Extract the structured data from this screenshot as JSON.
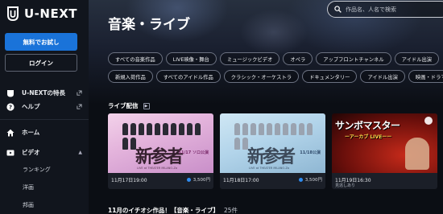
{
  "brand": {
    "logo_text": "U-NEXT"
  },
  "sidebar": {
    "trial_button": "無料でお試し",
    "login_button": "ログイン",
    "links": [
      {
        "label": "U-NEXTの特長"
      },
      {
        "label": "ヘルプ"
      }
    ],
    "nav": {
      "home": "ホーム",
      "video": "ビデオ",
      "video_sub": [
        "ランキング",
        "洋画",
        "邦画"
      ]
    }
  },
  "header": {
    "title": "音楽・ライブ",
    "search_placeholder": "作品名、人名で検索"
  },
  "chips": {
    "row1": [
      "すべての音楽作品",
      "LIVE映像・舞台",
      "ミュージックビデオ",
      "オペラ",
      "アップフロントチャンネル",
      "アイドル出演"
    ],
    "row2": [
      "新規入荷作品",
      "すべてのアイドル作品",
      "クラシック・オーケストラ",
      "ドキュメンタリー",
      "アイドル出演",
      "映画・ドラマ"
    ]
  },
  "live_section": {
    "title": "ライブ配信",
    "cards": [
      {
        "date": "11月17日19:00",
        "price": "3,500円",
        "thumb_text": "新参者",
        "corner": "11/17 ソロ公演"
      },
      {
        "date": "11月18日17:00",
        "price": "3,500円",
        "thumb_text": "新参者",
        "corner": "11/18公演"
      },
      {
        "date": "11月19日16:30",
        "price": "",
        "sub": "見逃しあり",
        "thumb_title": "サンボマスター",
        "thumb_sub": "ーアーカブ LIVEーー"
      }
    ]
  },
  "bottom_section": {
    "title": "11月のイチオシ作品！【音楽・ライブ】",
    "count": "25件"
  },
  "colors": {
    "accent": "#1a73d9",
    "background": "#0b0e14",
    "sidebar": "#11151d"
  }
}
